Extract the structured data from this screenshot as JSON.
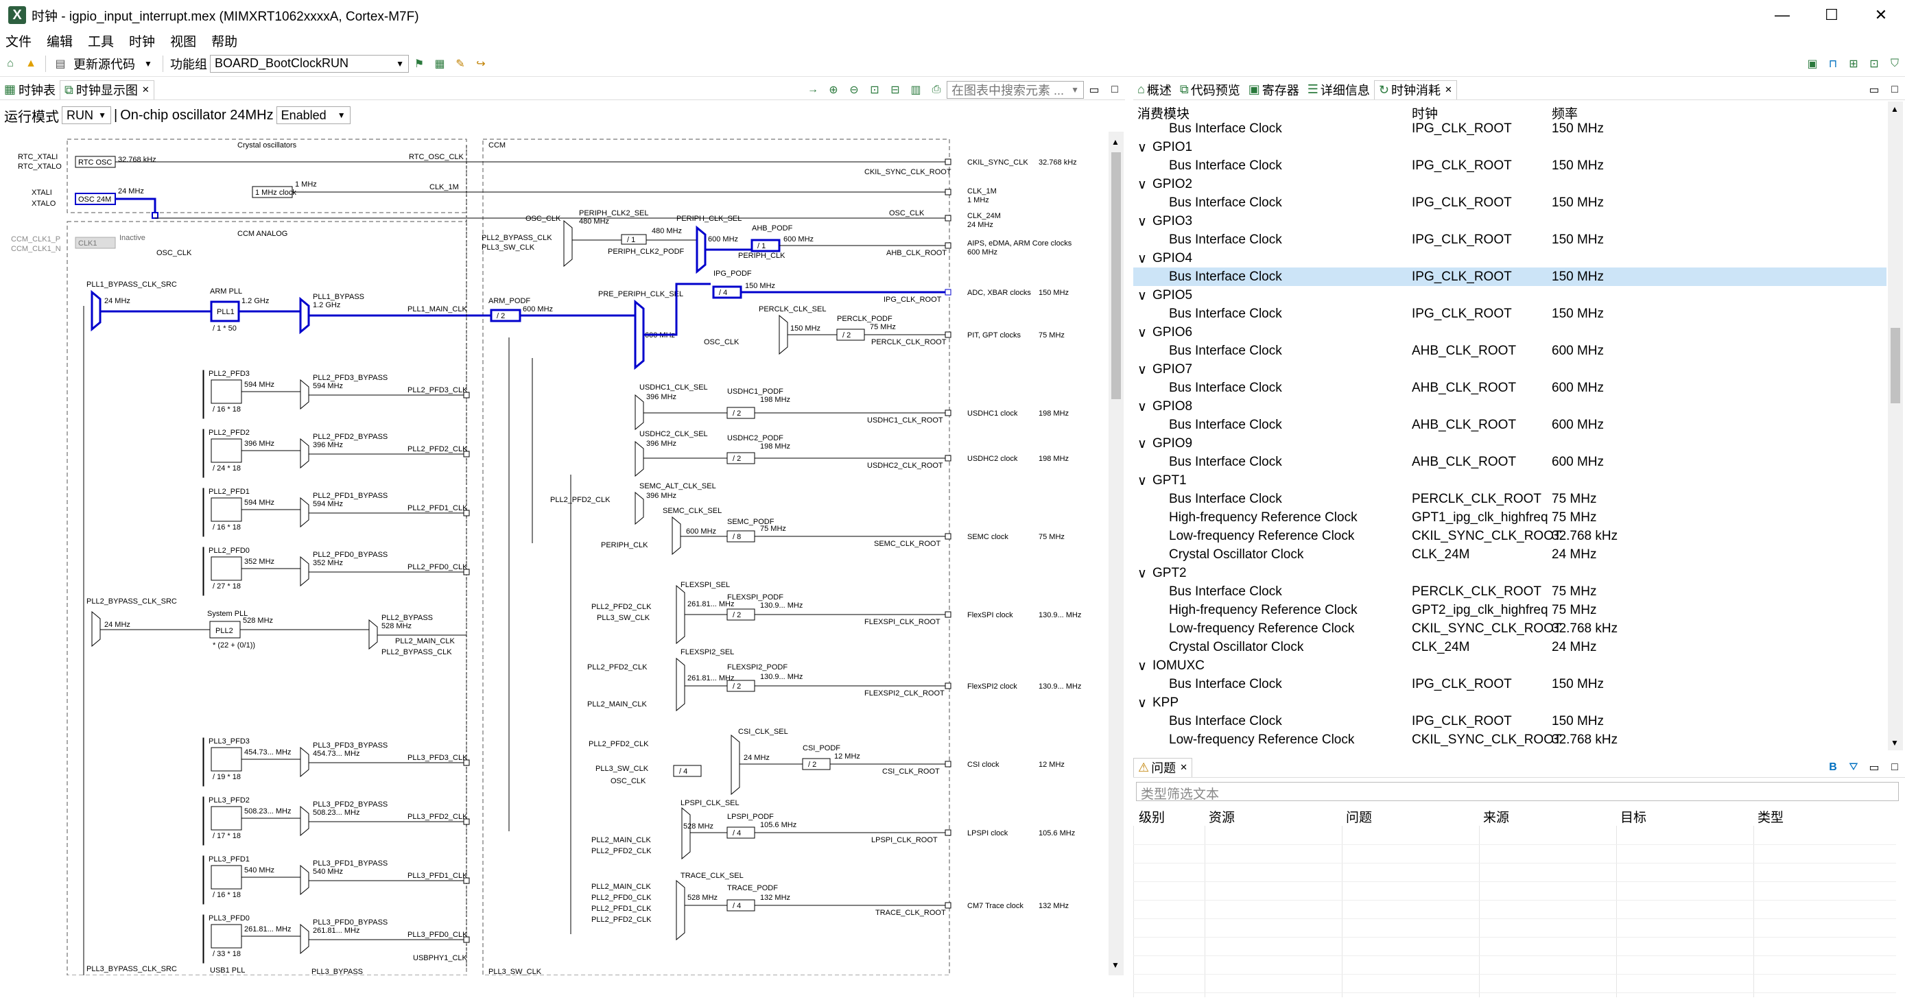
{
  "window": {
    "title": "时钟 - igpio_input_interrupt.mex (MIMXRT1062xxxxA, Cortex-M7F)",
    "minimize": "—",
    "maximize": "☐",
    "close": "✕",
    "app_icon": "X"
  },
  "menu": [
    "文件",
    "编辑",
    "工具",
    "时钟",
    "视图",
    "帮助"
  ],
  "toolbar": {
    "update_code": "更新源代码",
    "function_group_label": "功能组",
    "function_group_value": "BOARD_BootClockRUN"
  },
  "left_tabs": {
    "tab1": "时钟表",
    "tab2": "时钟显示图",
    "search_placeholder": "在图表中搜索元素 ..."
  },
  "run_bar": {
    "mode_label": "运行模式",
    "mode_value": "RUN",
    "osc_label": "On-chip oscillator 24MHz",
    "osc_value": "Enabled"
  },
  "diagram": {
    "sections": {
      "crystal": "Crystal oscillators",
      "ccm": "CCM",
      "ccm_analog": "CCM ANALOG"
    },
    "inputs": [
      "RTC_XTALI",
      "RTC_XTALO",
      "XTALI",
      "XTALO",
      "CCM_CLK1_P",
      "CCM_CLK1_N"
    ],
    "nodes": {
      "rtc_osc": "RTC OSC",
      "osc24m": "OSC 24M",
      "clk1": "CLK1",
      "inactive": "Inactive",
      "mhz1clock": "1 MHz clock",
      "osc_clk": "OSC_CLK",
      "pll1_bypass_src": "PLL1_BYPASS_CLK_SRC",
      "arm_pll": "ARM PLL",
      "pll1": "PLL1",
      "pll1_div": "/ 1 * 50",
      "pll1_bypass": "PLL1_BYPASS",
      "pll1_main": "PLL1_MAIN_CLK",
      "arm_podf": "ARM_PODF",
      "arm_podf_div": "/ 2",
      "pll2_bypass_src": "PLL2_BYPASS_CLK_SRC",
      "system_pll": "System PLL",
      "pll2": "PLL2",
      "pll2_div": "* (22 + (0/1))",
      "pll2_bypass": "PLL2_BYPASS",
      "pll2_main": "PLL2_MAIN_CLK",
      "pll2_bypass_clk": "PLL2_BYPASS_CLK",
      "pll3_bypass_src": "PLL3_BYPASS_CLK_SRC",
      "usb1_pll": "USB1 PLL",
      "usbphy1": "USBPHY1_CLK",
      "pll3_bypass": "PLL3_BYPASS",
      "pll3_sw_clk": "PLL3_SW_CLK"
    },
    "freqs": {
      "f32k": "32.768 kHz",
      "f24m": "24 MHz",
      "f1m": "1 MHz",
      "f1_2g": "1.2 GHz",
      "f600m": "600 MHz",
      "f528m": "528 MHz",
      "f480m": "480 MHz",
      "f150m": "150 MHz",
      "f75m": "75 MHz"
    },
    "pfd2": [
      {
        "name": "PLL2_PFD3",
        "freq": "594 MHz",
        "div": "/ 16 * 18",
        "byp": "PLL2_PFD3_BYPASS",
        "clk": "PLL2_PFD3_CLK"
      },
      {
        "name": "PLL2_PFD2",
        "freq": "396 MHz",
        "div": "/ 24 * 18",
        "byp": "PLL2_PFD2_BYPASS",
        "clk": "PLL2_PFD2_CLK"
      },
      {
        "name": "PLL2_PFD1",
        "freq": "594 MHz",
        "div": "/ 16 * 18",
        "byp": "PLL2_PFD1_BYPASS",
        "clk": "PLL2_PFD1_CLK"
      },
      {
        "name": "PLL2_PFD0",
        "freq": "352 MHz",
        "div": "/ 27 * 18",
        "byp": "PLL2_PFD0_BYPASS",
        "clk": "PLL2_PFD0_CLK"
      }
    ],
    "pfd3": [
      {
        "name": "PLL3_PFD3",
        "freq": "454.73... MHz",
        "div": "/ 19 * 18",
        "byp": "PLL3_PFD3_BYPASS",
        "clk": "PLL3_PFD3_CLK"
      },
      {
        "name": "PLL3_PFD2",
        "freq": "508.23... MHz",
        "div": "/ 17 * 18",
        "byp": "PLL3_PFD2_BYPASS",
        "clk": "PLL3_PFD2_CLK"
      },
      {
        "name": "PLL3_PFD1",
        "freq": "540 MHz",
        "div": "/ 16 * 18",
        "byp": "PLL3_PFD1_BYPASS",
        "clk": "PLL3_PFD1_CLK"
      },
      {
        "name": "PLL3_PFD0",
        "freq": "261.81... MHz",
        "div": "/ 33 * 18",
        "byp": "PLL3_PFD0_BYPASS",
        "clk": "PLL3_PFD0_CLK"
      }
    ],
    "outputs": [
      {
        "name": "CKIL_SYNC_CLK",
        "sub": "CKIL_SYNC_CLK_ROOT",
        "freq": "32.768 kHz"
      },
      {
        "name": "CLK_1M",
        "sub": "1 MHz",
        "freq": ""
      },
      {
        "name": "CLK_24M",
        "sub": "24 MHz",
        "freq": ""
      },
      {
        "name": "AIPS, eDMA, ARM Core clocks",
        "sub": "600 MHz",
        "freq": ""
      },
      {
        "name": "ADC, XBAR clocks",
        "sub": "",
        "freq": "150 MHz"
      },
      {
        "name": "PIT, GPT clocks",
        "sub": "",
        "freq": "75 MHz"
      },
      {
        "name": "USDHC1 clock",
        "sub": "",
        "freq": "198 MHz"
      },
      {
        "name": "USDHC2 clock",
        "sub": "",
        "freq": "198 MHz"
      },
      {
        "name": "SEMC clock",
        "sub": "",
        "freq": "75 MHz"
      },
      {
        "name": "FlexSPI clock",
        "sub": "",
        "freq": "130.9... MHz"
      },
      {
        "name": "FlexSPI2 clock",
        "sub": "",
        "freq": "130.9... MHz"
      },
      {
        "name": "CSI clock",
        "sub": "",
        "freq": "12 MHz"
      },
      {
        "name": "LPSPI clock",
        "sub": "",
        "freq": "105.6 MHz"
      },
      {
        "name": "CM7 Trace clock",
        "sub": "",
        "freq": "132 MHz"
      }
    ],
    "ccm": {
      "periph_clk2_sel": "PERIPH_CLK2_SEL",
      "periph_clk_sel": "PERIPH_CLK_SEL",
      "ahb_podf": "AHB_PODF",
      "ahb_root": "AHB_CLK_ROOT",
      "periph_clk": "PERIPH_CLK",
      "periph_clk2_podf": "PERIPH_CLK2_PODF",
      "pll2_bypass_clk": "PLL2_BYPASS_CLK",
      "pll3_sw_clk": "PLL3_SW_CLK",
      "pre_periph": "PRE_PERIPH_CLK_SEL",
      "ipg_podf": "IPG_PODF",
      "ipg_root": "IPG_CLK_ROOT",
      "perclk_sel": "PERCLK_CLK_SEL",
      "perclk_podf": "PERCLK_PODF",
      "perclk_root": "PERCLK_CLK_ROOT",
      "usdhc1_sel": "USDHC1_CLK_SEL",
      "usdhc1_podf": "USDHC1_PODF",
      "usdhc1_root": "USDHC1_CLK_ROOT",
      "usdhc2_sel": "USDHC2_CLK_SEL",
      "usdhc2_podf": "USDHC2_PODF",
      "usdhc2_root": "USDHC2_CLK_ROOT",
      "semc_alt": "SEMC_ALT_CLK_SEL",
      "semc_sel": "SEMC_CLK_SEL",
      "semc_podf": "SEMC_PODF",
      "semc_root": "SEMC_CLK_ROOT",
      "flexspi_sel": "FLEXSPI_SEL",
      "flexspi_podf": "FLEXSPI_PODF",
      "flexspi_root": "FLEXSPI_CLK_ROOT",
      "flexspi2_sel": "FLEXSPI2_SEL",
      "flexspi2_podf": "FLEXSPI2_PODF",
      "flexspi2_root": "FLEXSPI2_CLK_ROOT",
      "csi_sel": "CSI_CLK_SEL",
      "csi_podf": "CSI_PODF",
      "csi_root": "CSI_CLK_ROOT",
      "lpspi_sel": "LPSPI_CLK_SEL",
      "lpspi_podf": "LPSPI_PODF",
      "lpspi_root": "LPSPI_CLK_ROOT",
      "trace_sel": "TRACE_CLK_SEL",
      "trace_podf": "TRACE_PODF",
      "trace_root": "TRACE_CLK_ROOT",
      "div2": "/ 2",
      "div4": "/ 4",
      "div8": "/ 8",
      "div1": "/ 1",
      "pll2_pfd2": "PLL2_PFD2_CLK",
      "pll2_pfd0": "PLL2_PFD0_CLK",
      "pll2_pfd1": "PLL2_PFD1_CLK",
      "pll2_main": "PLL2_MAIN_CLK",
      "pll3_sw": "PLL3_SW_CLK",
      "osc_clk": "OSC_CLK",
      "periph": "PERIPH_CLK",
      "f396": "396 MHz",
      "f198": "198 MHz",
      "f261": "261.81... MHz",
      "f130": "130.9... MHz",
      "f12": "12 MHz",
      "f105": "105.6 MHz",
      "f132": "132 MHz",
      "f150": "150 MHz",
      "f24": "24 MHz",
      "f528": "528 MHz",
      "f600": "600 MHz",
      "f75": "75 MHz"
    }
  },
  "right_tabs": [
    "概述",
    "代码预览",
    "寄存器",
    "详细信息",
    "时钟消耗"
  ],
  "consumers": {
    "headers": [
      "消费模块",
      "时钟",
      "频率"
    ],
    "rows": [
      {
        "t": "i",
        "n": "Bus Interface Clock",
        "c": "IPG_CLK_ROOT",
        "f": "150 MHz"
      },
      {
        "t": "g",
        "n": "GPIO1"
      },
      {
        "t": "i",
        "n": "Bus Interface Clock",
        "c": "IPG_CLK_ROOT",
        "f": "150 MHz"
      },
      {
        "t": "g",
        "n": "GPIO2"
      },
      {
        "t": "i",
        "n": "Bus Interface Clock",
        "c": "IPG_CLK_ROOT",
        "f": "150 MHz"
      },
      {
        "t": "g",
        "n": "GPIO3"
      },
      {
        "t": "i",
        "n": "Bus Interface Clock",
        "c": "IPG_CLK_ROOT",
        "f": "150 MHz"
      },
      {
        "t": "g",
        "n": "GPIO4"
      },
      {
        "t": "i",
        "n": "Bus Interface Clock",
        "c": "IPG_CLK_ROOT",
        "f": "150 MHz",
        "sel": true
      },
      {
        "t": "g",
        "n": "GPIO5"
      },
      {
        "t": "i",
        "n": "Bus Interface Clock",
        "c": "IPG_CLK_ROOT",
        "f": "150 MHz"
      },
      {
        "t": "g",
        "n": "GPIO6"
      },
      {
        "t": "i",
        "n": "Bus Interface Clock",
        "c": "AHB_CLK_ROOT",
        "f": "600 MHz"
      },
      {
        "t": "g",
        "n": "GPIO7"
      },
      {
        "t": "i",
        "n": "Bus Interface Clock",
        "c": "AHB_CLK_ROOT",
        "f": "600 MHz"
      },
      {
        "t": "g",
        "n": "GPIO8"
      },
      {
        "t": "i",
        "n": "Bus Interface Clock",
        "c": "AHB_CLK_ROOT",
        "f": "600 MHz"
      },
      {
        "t": "g",
        "n": "GPIO9"
      },
      {
        "t": "i",
        "n": "Bus Interface Clock",
        "c": "AHB_CLK_ROOT",
        "f": "600 MHz"
      },
      {
        "t": "g",
        "n": "GPT1"
      },
      {
        "t": "i",
        "n": "Bus Interface Clock",
        "c": "PERCLK_CLK_ROOT",
        "f": "75 MHz"
      },
      {
        "t": "i",
        "n": "High-frequency Reference Clock",
        "c": "GPT1_ipg_clk_highfreq",
        "f": "75 MHz"
      },
      {
        "t": "i",
        "n": "Low-frequency Reference Clock",
        "c": "CKIL_SYNC_CLK_ROOT",
        "f": "32.768 kHz"
      },
      {
        "t": "i",
        "n": "Crystal Oscillator Clock",
        "c": "CLK_24M",
        "f": "24 MHz"
      },
      {
        "t": "g",
        "n": "GPT2"
      },
      {
        "t": "i",
        "n": "Bus Interface Clock",
        "c": "PERCLK_CLK_ROOT",
        "f": "75 MHz"
      },
      {
        "t": "i",
        "n": "High-frequency Reference Clock",
        "c": "GPT2_ipg_clk_highfreq",
        "f": "75 MHz"
      },
      {
        "t": "i",
        "n": "Low-frequency Reference Clock",
        "c": "CKIL_SYNC_CLK_ROOT",
        "f": "32.768 kHz"
      },
      {
        "t": "i",
        "n": "Crystal Oscillator Clock",
        "c": "CLK_24M",
        "f": "24 MHz"
      },
      {
        "t": "g",
        "n": "IOMUXC"
      },
      {
        "t": "i",
        "n": "Bus Interface Clock",
        "c": "IPG_CLK_ROOT",
        "f": "150 MHz"
      },
      {
        "t": "g",
        "n": "KPP"
      },
      {
        "t": "i",
        "n": "Bus Interface Clock",
        "c": "IPG_CLK_ROOT",
        "f": "150 MHz"
      },
      {
        "t": "i",
        "n": "Low-frequency Reference Clock",
        "c": "CKIL_SYNC_CLK_ROOT",
        "f": "32.768 kHz"
      }
    ]
  },
  "problems": {
    "tab": "问题",
    "filter_placeholder": "类型筛选文本",
    "headers": [
      "级别",
      "资源",
      "问题",
      "来源",
      "目标",
      "类型"
    ]
  },
  "colors": {
    "active_path": "#0000cc",
    "line": "#000000",
    "selected_row": "#cce4f7"
  }
}
